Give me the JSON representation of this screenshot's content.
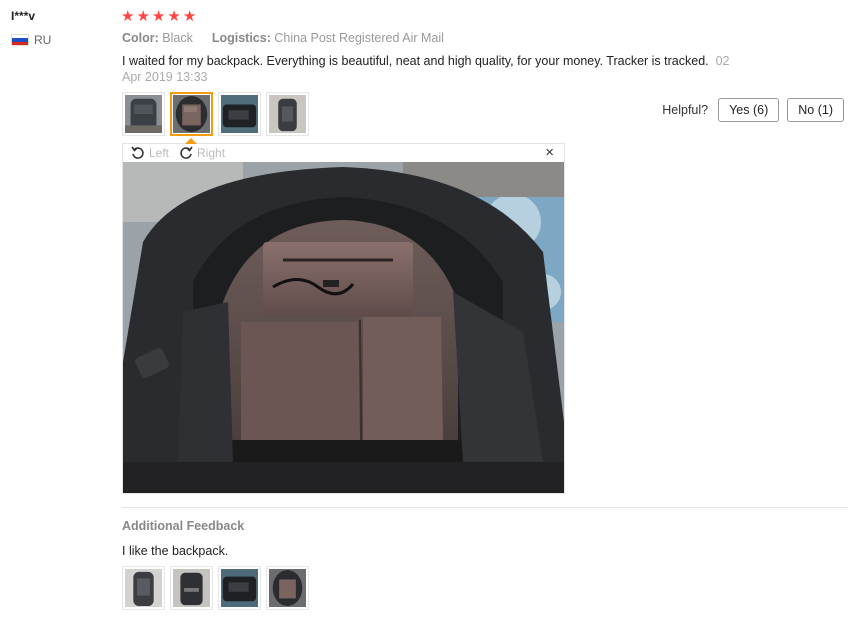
{
  "reviewer": {
    "name": "I***v",
    "country_code": "RU",
    "flag_colors": [
      "#ffffff",
      "#1f4fc2",
      "#d52b1e"
    ]
  },
  "rating": {
    "stars": 5,
    "max": 5,
    "star_glyph": "★",
    "color": "#ff4747"
  },
  "attributes": {
    "color_label": "Color:",
    "color_value": "Black",
    "logistics_label": "Logistics:",
    "logistics_value": "China Post Registered Air Mail"
  },
  "review": {
    "text": "I waited for my backpack. Everything is beautiful, neat and high quality, for your money. Tracker is tracked.",
    "date": "02 Apr 2019 13:33"
  },
  "helpful": {
    "label": "Helpful?",
    "yes_label": "Yes (6)",
    "no_label": "No (1)"
  },
  "viewer": {
    "rotate_left_label": "Left",
    "rotate_right_label": "Right",
    "close_glyph": "×",
    "active_thumb_index": 2,
    "accent_color": "#f39c12"
  },
  "additional_feedback": {
    "title": "Additional Feedback",
    "text": "I like the backpack."
  }
}
